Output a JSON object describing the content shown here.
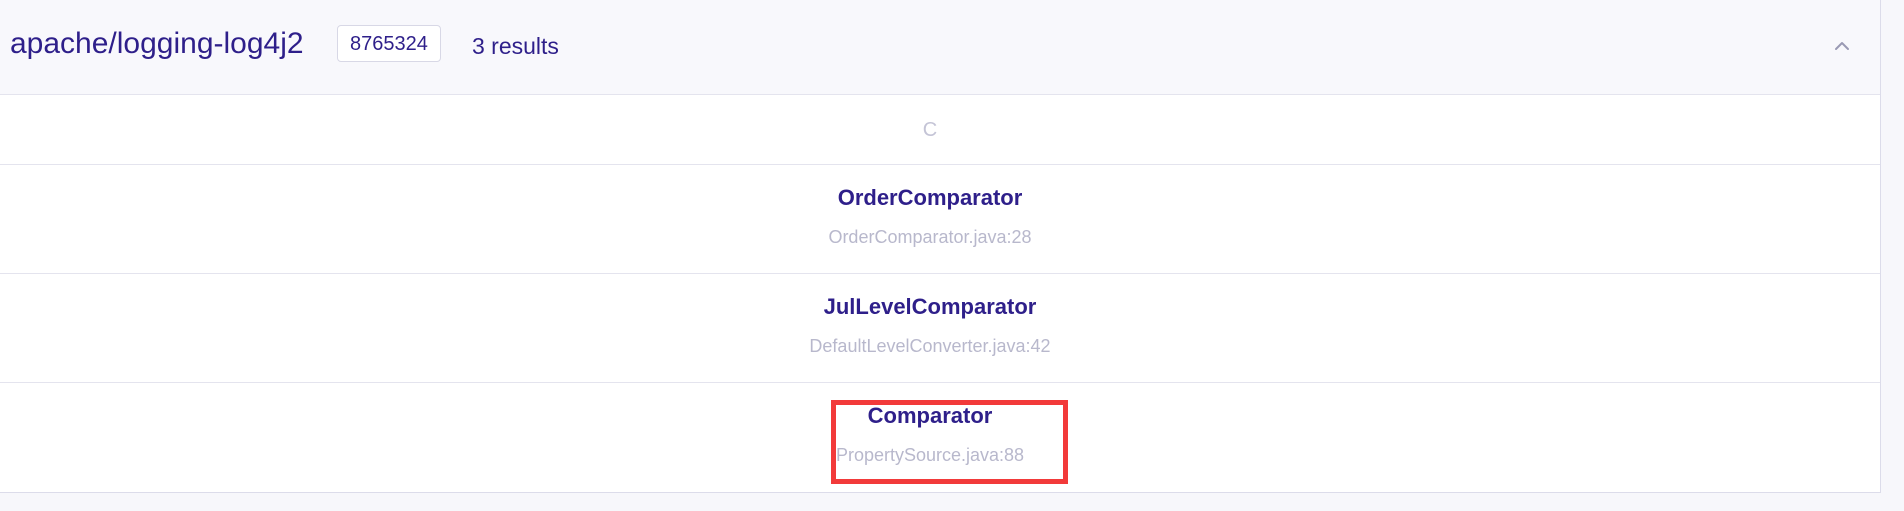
{
  "header": {
    "repo_name": "apache/logging-log4j2",
    "commit_id": "8765324",
    "results_label": "3 results",
    "collapse_icon": "chevron-up-icon"
  },
  "section": {
    "letter": "C"
  },
  "results": [
    {
      "name": "OrderComparator",
      "location": "OrderComparator.java:28"
    },
    {
      "name": "JulLevelComparator",
      "location": "DefaultLevelConverter.java:42"
    },
    {
      "name": "Comparator",
      "location": "PropertySource.java:88"
    }
  ],
  "colors": {
    "accent": "#2e1f8a",
    "muted": "#b8b8cc",
    "highlight": "#f23a3a"
  }
}
